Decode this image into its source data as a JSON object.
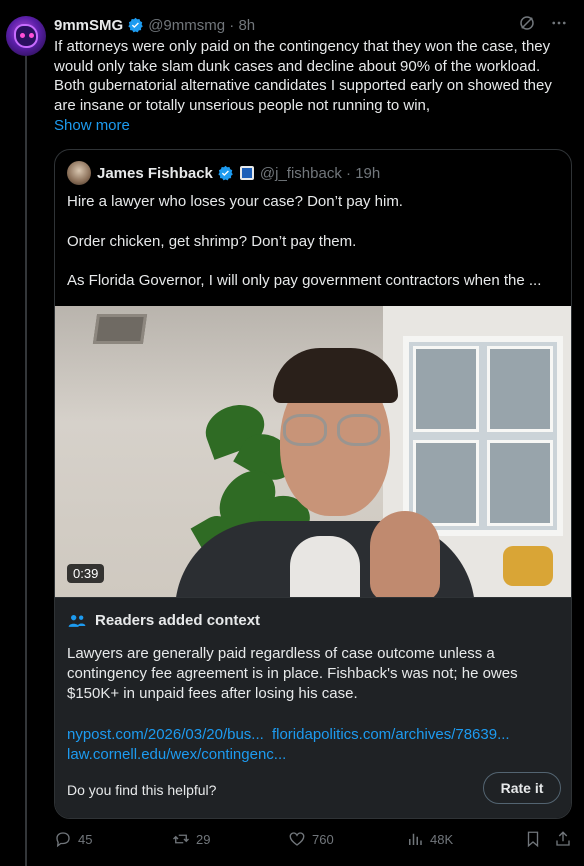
{
  "post": {
    "display_name": "9mmSMG",
    "handle": "@9mmsmg",
    "time": "8h",
    "text": "If attorneys were only paid on the contingency that they won the case, they would only take slam dunk cases and decline about 90% of the workload. Both gubernatorial alternative candidates I supported early on showed they are insane or totally unserious people not running to win,",
    "show_more": "Show more"
  },
  "quote": {
    "display_name": "James Fishback",
    "handle": "@j_fishback",
    "time": "19h",
    "lines": [
      "Hire a lawyer who loses your case? Don’t pay him.",
      "Order chicken, get shrimp? Don’t  pay them.",
      "As Florida Governor, I will only pay government contractors when the ..."
    ],
    "video_duration": "0:39"
  },
  "community_note": {
    "title": "Readers added context",
    "body": "Lawyers are generally paid regardless of case outcome unless a contingency fee agreement is in place. Fishback's was not; he owes $150K+ in unpaid fees after losing his case.",
    "links": [
      "nypost.com/2026/03/20/bus...",
      "floridapolitics.com/archives/78639...",
      "law.cornell.edu/wex/contingenc..."
    ],
    "question": "Do you find this helpful?",
    "rate_button": "Rate it"
  },
  "actions": {
    "replies": "45",
    "reposts": "29",
    "likes": "760",
    "views": "48K"
  },
  "colors": {
    "background": "#000000",
    "link": "#1d9bf0",
    "muted": "#71767b",
    "verified": "#1d9bf0"
  },
  "icons": [
    "grok-icon",
    "more-icon",
    "verified-icon",
    "people-icon",
    "reply-icon",
    "repost-icon",
    "like-icon",
    "views-icon",
    "bookmark-icon",
    "share-icon"
  ]
}
